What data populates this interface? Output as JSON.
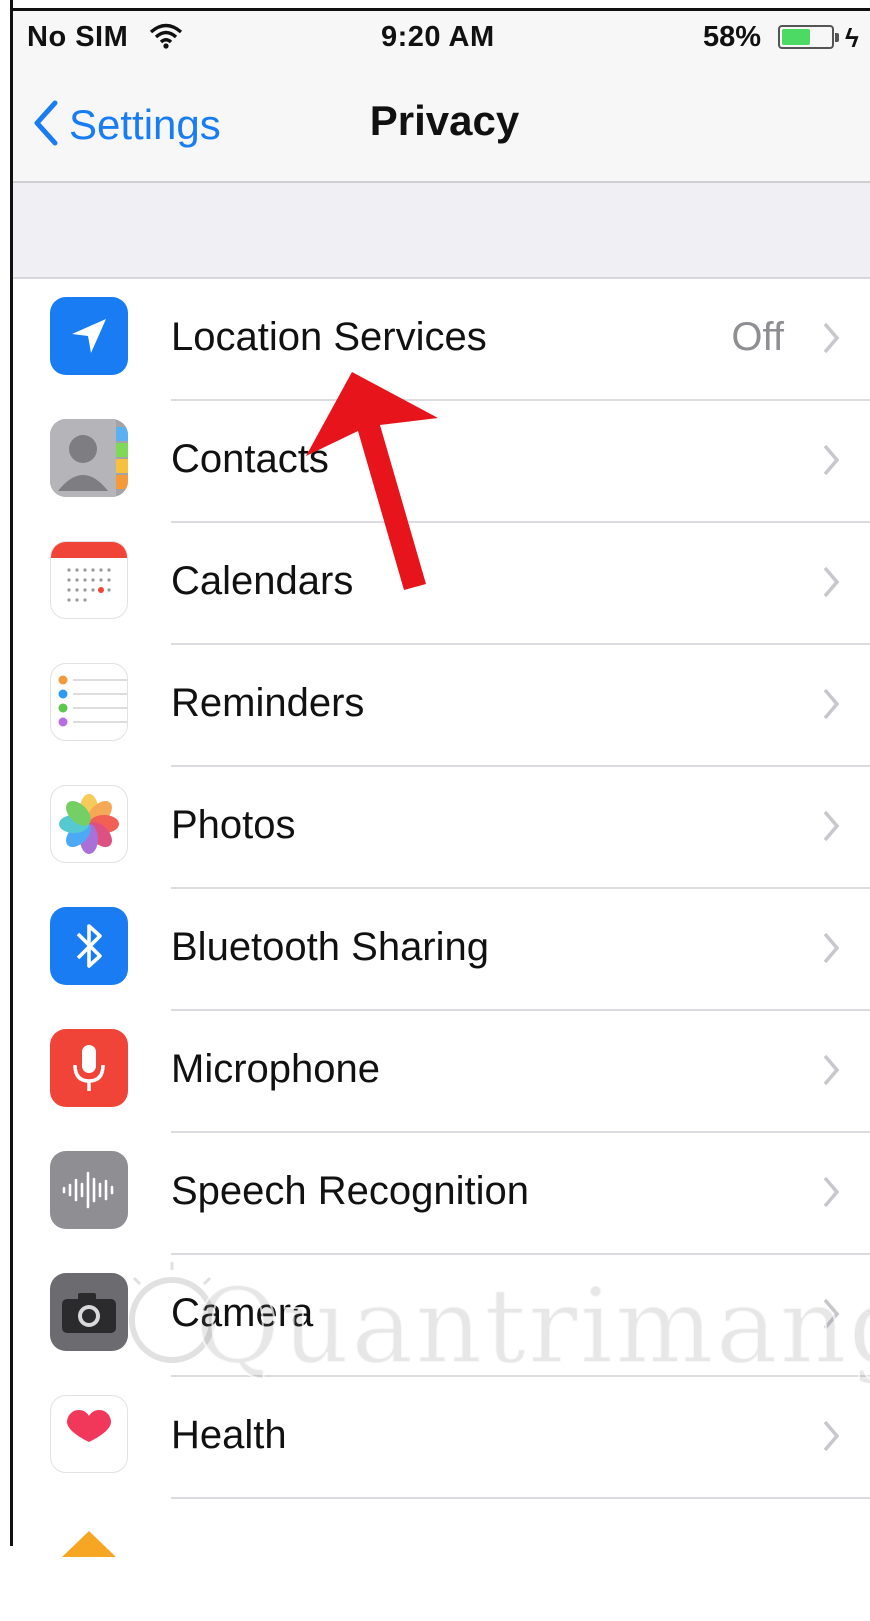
{
  "status_bar": {
    "carrier": "No SIM",
    "time": "9:20 AM",
    "battery_percent": "58%",
    "battery_level": 0.58
  },
  "nav": {
    "back_label": "Settings",
    "title": "Privacy"
  },
  "rows": [
    {
      "label": "Location Services",
      "value": "Off",
      "icon": "location-arrow-icon",
      "icon_bg": "#1a7cf2"
    },
    {
      "label": "Contacts",
      "value": "",
      "icon": "contacts-icon",
      "icon_bg": "#a3a3a8"
    },
    {
      "label": "Calendars",
      "value": "",
      "icon": "calendar-icon",
      "icon_bg": "#ffffff"
    },
    {
      "label": "Reminders",
      "value": "",
      "icon": "reminders-icon",
      "icon_bg": "#ffffff"
    },
    {
      "label": "Photos",
      "value": "",
      "icon": "photos-icon",
      "icon_bg": "#ffffff"
    },
    {
      "label": "Bluetooth Sharing",
      "value": "",
      "icon": "bluetooth-icon",
      "icon_bg": "#1a7cf2"
    },
    {
      "label": "Microphone",
      "value": "",
      "icon": "microphone-icon",
      "icon_bg": "#f04438"
    },
    {
      "label": "Speech Recognition",
      "value": "",
      "icon": "speech-waveform-icon",
      "icon_bg": "#8e8e93"
    },
    {
      "label": "Camera",
      "value": "",
      "icon": "camera-icon",
      "icon_bg": "#5a5a5e"
    },
    {
      "label": "Health",
      "value": "",
      "icon": "health-heart-icon",
      "icon_bg": "#ffffff"
    },
    {
      "label": "",
      "value": "",
      "icon": "homekit-icon",
      "icon_bg": "#f6a623"
    }
  ],
  "watermark": {
    "text": "Quantrimang"
  },
  "colors": {
    "accent": "#1a7cf2",
    "annotation_arrow": "#e8141c"
  }
}
